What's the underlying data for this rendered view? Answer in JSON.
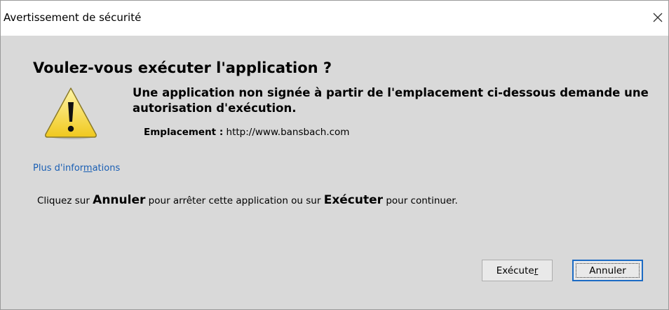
{
  "window": {
    "title": "Avertissement de sécurité",
    "close_icon": "close-icon"
  },
  "dialog": {
    "heading": "Voulez-vous exécuter l'application ?",
    "warning_icon": "warning-icon",
    "message": "Une application non signée à partir de l'emplacement ci-dessous demande une autorisation d'exécution.",
    "location_label": "Emplacement :",
    "location_value": "http://www.bansbach.com",
    "more_info": {
      "before": "Plus d'infor",
      "mnemonic": "m",
      "after": "ations"
    },
    "instructions": {
      "part1": "Cliquez sur ",
      "cancel_word": "Annuler",
      "part2": " pour arrêter cette application ou sur ",
      "run_word": "Exécuter",
      "part3": " pour continuer."
    }
  },
  "buttons": {
    "run_label": "Exécute",
    "run_mnemonic": "r",
    "cancel_label": "Annuler"
  },
  "colors": {
    "dialog_background": "#d9d9d9",
    "link": "#1a5fb4",
    "warning_fill": "#f4d93a",
    "default_button_border": "#1c6bc4"
  }
}
